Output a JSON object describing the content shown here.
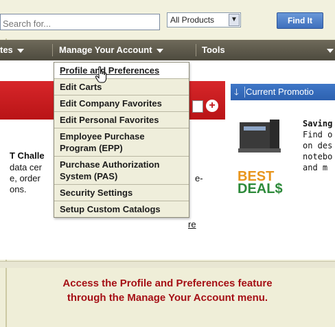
{
  "search": {
    "placeholder": "Search for...",
    "category_selected": "All Products",
    "find_label": "Find It"
  },
  "nav": {
    "items": [
      {
        "label": "tes"
      },
      {
        "label": "Manage Your Account"
      },
      {
        "label": "Tools"
      }
    ]
  },
  "dropdown": {
    "items": [
      "Profile and Preferences",
      "Edit Carts",
      "Edit Company Favorites",
      "Edit Personal Favorites",
      "Employee Purchase Program (EPP)",
      "Purchase Authorization System (PAS)",
      "Security Settings",
      "Setup Custom Catalogs"
    ]
  },
  "content": {
    "line1": "T Challe",
    "line2": "data cer",
    "line3": "e, order",
    "line4": "ons.",
    "line3_suffix": "e-",
    "link_fragment": "re"
  },
  "promo": {
    "header": "Current Promotio",
    "best": "BEST",
    "deals": "DEAL$",
    "lines": [
      "Saving",
      "Find o",
      "on des",
      "notebo",
      "and m"
    ]
  },
  "caption": {
    "line1": "Access the Profile and Preferences feature",
    "line2": "through the Manage Your Account menu."
  },
  "colors": {
    "accent_red": "#a51016",
    "nav_bg": "#5a5648",
    "promo_blue": "#3468b8"
  }
}
